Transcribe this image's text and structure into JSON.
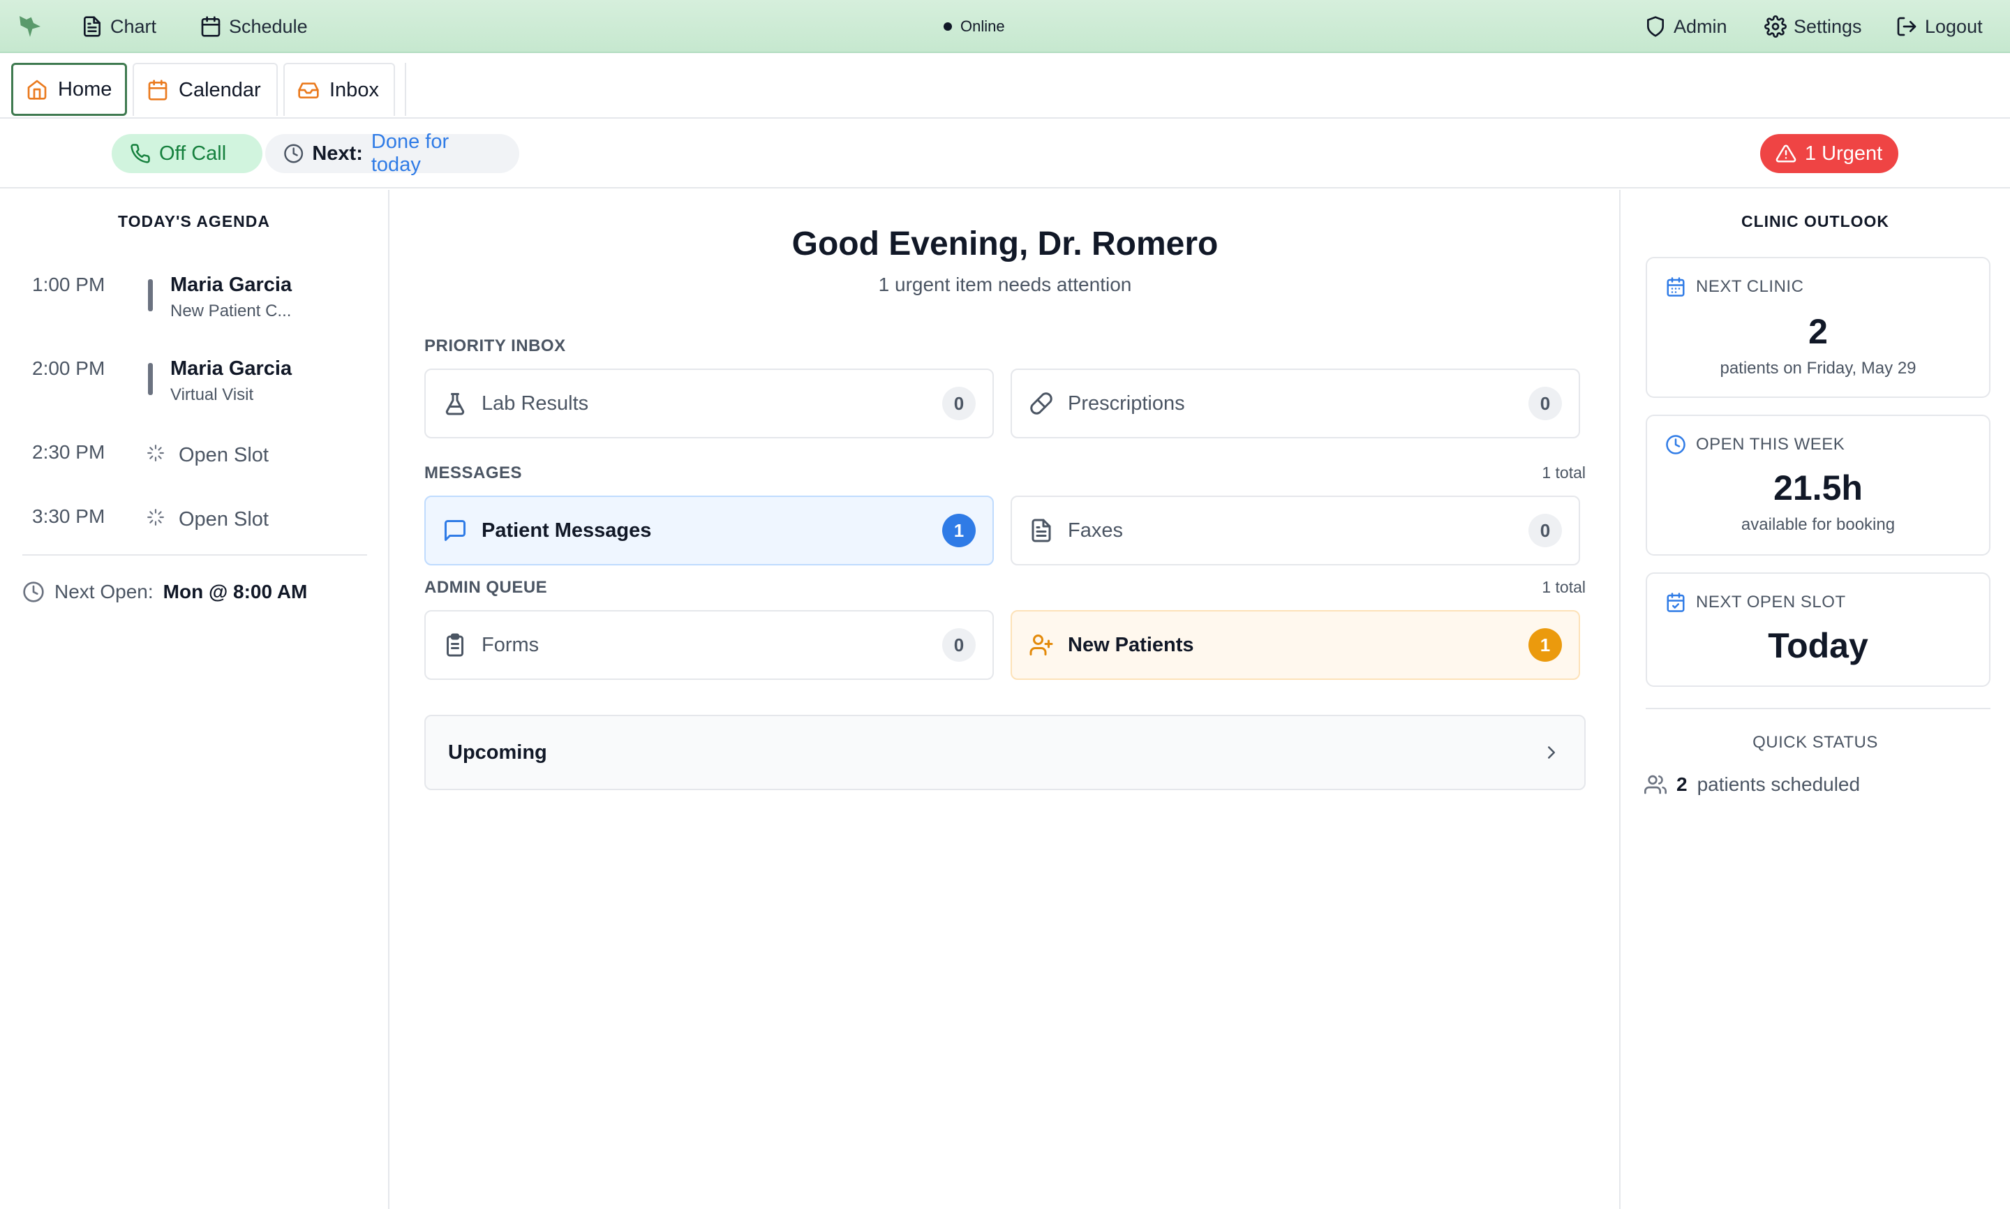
{
  "topbar": {
    "nav_left": [
      {
        "label": "Chart",
        "icon": "file-text-icon"
      },
      {
        "label": "Schedule",
        "icon": "calendar-icon"
      }
    ],
    "status": "Online",
    "nav_right": [
      {
        "label": "Admin",
        "icon": "shield-icon"
      },
      {
        "label": "Settings",
        "icon": "gear-icon"
      },
      {
        "label": "Logout",
        "icon": "logout-icon"
      }
    ]
  },
  "tabs": [
    {
      "label": "Home",
      "icon": "home-icon",
      "active": true
    },
    {
      "label": "Calendar",
      "icon": "calendar-icon",
      "active": false
    },
    {
      "label": "Inbox",
      "icon": "inbox-icon",
      "active": false
    }
  ],
  "status_row": {
    "call_status": "Off Call",
    "next_label": "Next:",
    "next_value": "Done for today",
    "urgent": "1 Urgent"
  },
  "agenda": {
    "title": "TODAY'S AGENDA",
    "items": [
      {
        "time": "1:00 PM",
        "name": "Maria Garcia",
        "detail": "New Patient C..."
      },
      {
        "time": "2:00 PM",
        "name": "Maria Garcia",
        "detail": "Virtual Visit"
      },
      {
        "time": "2:30 PM",
        "open": "Open Slot"
      },
      {
        "time": "3:30 PM",
        "open": "Open Slot"
      }
    ],
    "next_open_label": "Next Open:",
    "next_open_value": "Mon @ 8:00 AM"
  },
  "main": {
    "greeting": "Good Evening, Dr. Romero",
    "subtitle": "1 urgent item needs attention",
    "priority_inbox": {
      "label": "PRIORITY INBOX",
      "cards": [
        {
          "label": "Lab Results",
          "count": "0"
        },
        {
          "label": "Prescriptions",
          "count": "0"
        }
      ]
    },
    "messages": {
      "label": "MESSAGES",
      "total": "1 total",
      "cards": [
        {
          "label": "Patient Messages",
          "count": "1"
        },
        {
          "label": "Faxes",
          "count": "0"
        }
      ]
    },
    "admin_queue": {
      "label": "ADMIN QUEUE",
      "total": "1 total",
      "cards": [
        {
          "label": "Forms",
          "count": "0"
        },
        {
          "label": "New Patients",
          "count": "1"
        }
      ]
    },
    "upcoming": "Upcoming"
  },
  "outlook": {
    "title": "CLINIC OUTLOOK",
    "next_clinic": {
      "label": "NEXT CLINIC",
      "value": "2",
      "detail": "patients on Friday, May 29"
    },
    "open_week": {
      "label": "OPEN THIS WEEK",
      "value": "21.5h",
      "detail": "available for booking"
    },
    "next_slot": {
      "label": "NEXT OPEN SLOT",
      "value": "Today"
    },
    "quick_status_title": "QUICK STATUS",
    "quick_status_count": "2",
    "quick_status_text": "patients scheduled"
  },
  "colors": {
    "topbar_bg": "#c6e8cf",
    "active_tab_border": "#3f7a50",
    "tab_icon": "#ea7a1e",
    "off_call_bg": "#d1f4de",
    "urgent_bg": "#ef4444",
    "accent_blue": "#2f7be6",
    "accent_orange": "#eb9a0d"
  }
}
